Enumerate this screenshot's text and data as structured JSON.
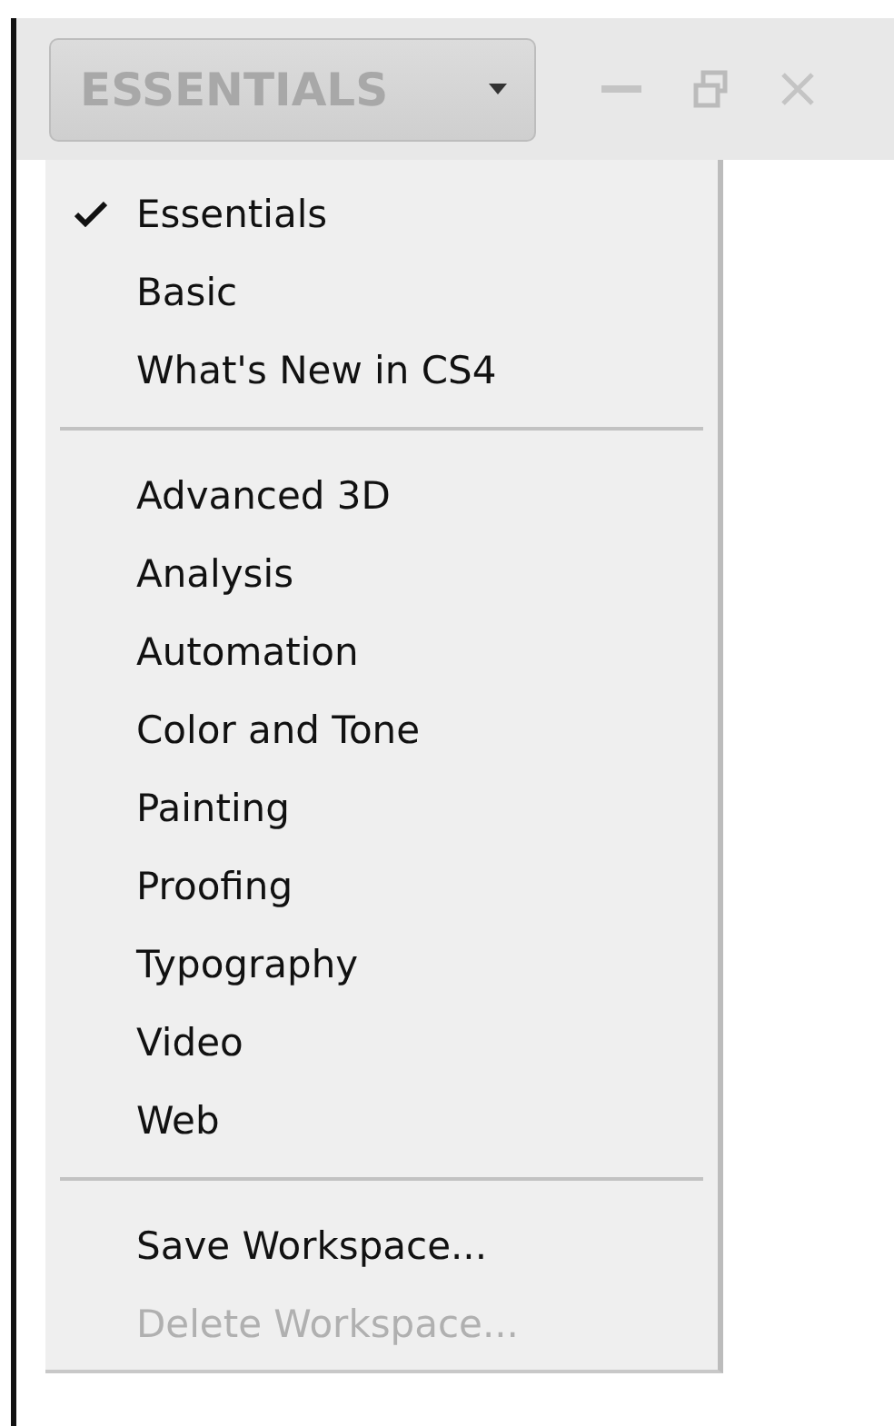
{
  "workspace_button": {
    "label": "ESSENTIALS"
  },
  "menu": {
    "groups": [
      {
        "items": [
          {
            "label": "Essentials",
            "checked": true,
            "disabled": false
          },
          {
            "label": "Basic",
            "checked": false,
            "disabled": false
          },
          {
            "label": "What's New in CS4",
            "checked": false,
            "disabled": false
          }
        ]
      },
      {
        "items": [
          {
            "label": "Advanced 3D",
            "checked": false,
            "disabled": false
          },
          {
            "label": "Analysis",
            "checked": false,
            "disabled": false
          },
          {
            "label": "Automation",
            "checked": false,
            "disabled": false
          },
          {
            "label": "Color and Tone",
            "checked": false,
            "disabled": false
          },
          {
            "label": "Painting",
            "checked": false,
            "disabled": false
          },
          {
            "label": "Proofing",
            "checked": false,
            "disabled": false
          },
          {
            "label": "Typography",
            "checked": false,
            "disabled": false
          },
          {
            "label": "Video",
            "checked": false,
            "disabled": false
          },
          {
            "label": "Web",
            "checked": false,
            "disabled": false
          }
        ]
      },
      {
        "items": [
          {
            "label": "Save Workspace...",
            "checked": false,
            "disabled": false
          },
          {
            "label": "Delete Workspace...",
            "checked": false,
            "disabled": true
          }
        ]
      }
    ]
  }
}
